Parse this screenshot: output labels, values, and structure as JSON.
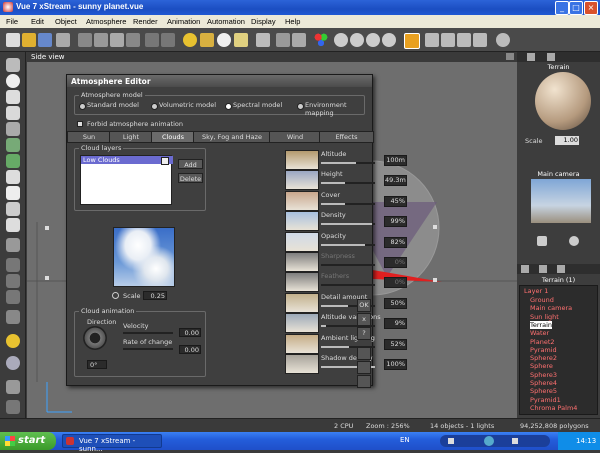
{
  "window": {
    "title": "Vue 7 xStream - sunny planet.vue"
  },
  "menu": [
    "File",
    "Edit",
    "Object",
    "Atmosphere",
    "Render",
    "Animation",
    "Automation",
    "Display",
    "Help"
  ],
  "viewport": {
    "label": "Side view"
  },
  "dialog": {
    "title": "Atmosphere Editor",
    "model_group": "Atmosphere model",
    "models": [
      "Standard model",
      "Volumetric model",
      "Spectral model",
      "Environment mapping"
    ],
    "selected_model": "Spectral model",
    "forbid_label": "Forbid atmosphere animation",
    "tabs": [
      "Sun",
      "Light",
      "Clouds",
      "Sky, Fog and Haze",
      "Wind",
      "Effects"
    ],
    "active_tab": "Clouds",
    "cloud_layers_label": "Cloud layers",
    "layer_item": "Low Clouds",
    "add_label": "Add",
    "delete_label": "Delete",
    "scale_label": "Scale",
    "scale_value": "0.25",
    "anim_group": "Cloud animation",
    "direction_label": "Direction",
    "velocity_label": "Velocity",
    "velocity_value": "0.00",
    "rate_label": "Rate of change",
    "rate_value": "0.00",
    "direction_value": "0°",
    "sliders": [
      {
        "label": "Altitude",
        "value": "100m",
        "level": 0.65,
        "enabled": true
      },
      {
        "label": "Height",
        "value": "49.3m",
        "level": 0.45,
        "enabled": true
      },
      {
        "label": "Cover",
        "value": "45%",
        "level": 0.45,
        "enabled": true
      },
      {
        "label": "Density",
        "value": "99%",
        "level": 0.95,
        "enabled": true
      },
      {
        "label": "Opacity",
        "value": "82%",
        "level": 0.82,
        "enabled": true
      },
      {
        "label": "Sharpness",
        "value": "0%",
        "level": 0.0,
        "enabled": false
      },
      {
        "label": "Feathers",
        "value": "0%",
        "level": 0.0,
        "enabled": false
      },
      {
        "label": "Detail amount",
        "value": "50%",
        "level": 0.5,
        "enabled": true
      },
      {
        "label": "Altitude variations",
        "value": "9%",
        "level": 0.1,
        "enabled": true
      },
      {
        "label": "Ambient lighting",
        "value": "52%",
        "level": 0.52,
        "enabled": true
      },
      {
        "label": "Shadow density",
        "value": "100%",
        "level": 1.0,
        "enabled": true
      }
    ],
    "ok_label": "OK",
    "cancel_label": "x",
    "help_label": "?"
  },
  "right": {
    "material_label": "Terrain",
    "scale_label": "Scale",
    "scale_value": "1.00",
    "camera_label": "Main camera",
    "layer_title": "Terrain (1)",
    "layer_root": "Layer 1",
    "objects": [
      "Ground",
      "Main camera",
      "Sun light",
      "Terrain",
      "Water",
      "Planet2",
      "Pyramid",
      "Sphere2",
      "Sphere",
      "Sphere3",
      "Sphere4",
      "Sphere5",
      "Pyramid1",
      "Chroma Palm4"
    ],
    "selected_object": "Terrain"
  },
  "status": {
    "cpu": "2 CPU",
    "zoom": "Zoom : 256%",
    "objects": "14 objects - 1 lights",
    "polygons": "94,252,808 polygons"
  },
  "taskbar": {
    "start": "start",
    "task": "Vue 7 xStream - sunn...",
    "lang": "EN",
    "clock": "14:13"
  },
  "colors": {
    "accent": "#2c63d8",
    "selection": "#6b6bd0",
    "panel": "#3f3f3f"
  }
}
